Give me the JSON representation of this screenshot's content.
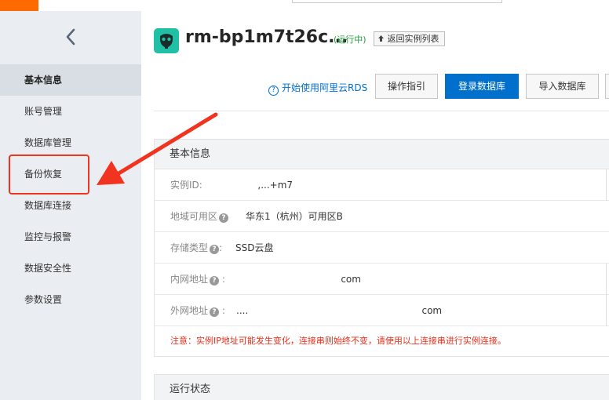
{
  "sidebar": {
    "back_glyph": "<",
    "items": [
      {
        "label": "基本信息",
        "active": true
      },
      {
        "label": "账号管理"
      },
      {
        "label": "数据库管理"
      },
      {
        "label": "备份恢复",
        "highlighted": true
      },
      {
        "label": "数据库连接"
      },
      {
        "label": "监控与报警"
      },
      {
        "label": "数据安全性"
      },
      {
        "label": "参数设置"
      }
    ]
  },
  "header": {
    "title": "rm-bp1m7t26c...",
    "status": "(运行中)",
    "back_to_list": "返回实例列表",
    "back_to_list_icon": "upload-arrow-icon",
    "help_link": "开始使用阿里云RDS",
    "help_icon": "question-circle-icon",
    "buttons": {
      "guide": "操作指引",
      "login_db": "登录数据库",
      "import_db": "导入数据库"
    }
  },
  "basic_info": {
    "section_title": "基本信息",
    "rows": [
      {
        "label": "实例ID:",
        "value": "              ,...+m7",
        "help": false
      },
      {
        "label": "地域可用区",
        "value": "华东1（杭州）可用区B",
        "help": true
      },
      {
        "label": "存储类型",
        "value": "SSD云盘",
        "help": true
      },
      {
        "label": "内网地址",
        "value": "                                    com",
        "help": true
      },
      {
        "label": "外网地址",
        "value": "....                                                          com",
        "help": true
      }
    ],
    "notice": "注意：实例IP地址可能发生变化，连接串则始终不变，请使用以上连接串进行实例连接。"
  },
  "run_status": {
    "section_title": "运行状态"
  },
  "colors": {
    "accent": "#0070cc",
    "brand_orange": "#ff6a00",
    "annotation_red": "#f0341f",
    "status_green": "#1e9c3a",
    "warning_red": "#e62e1a"
  }
}
